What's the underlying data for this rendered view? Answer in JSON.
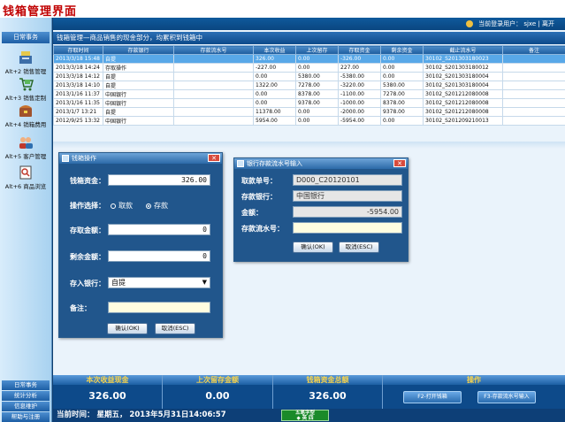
{
  "page_title": "钱箱管理界面",
  "topbar": {
    "user_label": "当前登录用户：",
    "user_name": "sjxe",
    "sep": "|",
    "logout": "离开"
  },
  "sidebar": {
    "header": "日常事务",
    "items": [
      {
        "label": "Alt+2 销售管理",
        "icon": "cash-register-icon"
      },
      {
        "label": "Alt+3 销售定制",
        "icon": "shopping-cart-icon"
      },
      {
        "label": "Alt+4 销箱费用",
        "icon": "money-chest-icon"
      },
      {
        "label": "Alt+5 客户管理",
        "icon": "customers-icon"
      },
      {
        "label": "Alt+6 商品浏览",
        "icon": "product-browse-icon"
      }
    ],
    "bottom": [
      "日常事务",
      "统计分析",
      "信息维护",
      "帮助与注册"
    ]
  },
  "main": {
    "header": "钱箱管理—商品销售的现金部分，均累积到钱箱中",
    "columns": [
      "存取时间",
      "存款银行",
      "存款流水号",
      "本次收益",
      "上次留存",
      "存取资金",
      "剩余资金",
      "截止流水号",
      "备注"
    ],
    "rows": [
      [
        "2013/3/18 15:48",
        "自提",
        "",
        "326.00",
        "0.00",
        "-326.00",
        "0.00",
        "30102_S201303180023",
        ""
      ],
      [
        "2013/3/18 14:24",
        "存取操作",
        "",
        "-227.00",
        "0.00",
        "227.00",
        "0.00",
        "30102_S201303180012",
        ""
      ],
      [
        "2013/3/18 14:12",
        "自提",
        "",
        "0.00",
        "5380.00",
        "-5380.00",
        "0.00",
        "30102_S201303180004",
        ""
      ],
      [
        "2013/3/18 14:10",
        "自提",
        "",
        "1322.00",
        "7278.00",
        "-3220.00",
        "5380.00",
        "30102_S201303180004",
        ""
      ],
      [
        "2013/1/16 11:37",
        "中国银行",
        "",
        "0.00",
        "8378.00",
        "-1100.00",
        "7278.00",
        "30102_S201212080008",
        ""
      ],
      [
        "2013/1/16 11:35",
        "中国银行",
        "",
        "0.00",
        "9378.00",
        "-1000.00",
        "8378.00",
        "30102_S201212080008",
        ""
      ],
      [
        "2013/1/7 13:21",
        "自提",
        "",
        "11378.00",
        "0.00",
        "-2000.00",
        "9378.00",
        "30102_S201212080008",
        ""
      ],
      [
        "2012/9/25 13:32",
        "中国银行",
        "",
        "5954.00",
        "0.00",
        "-5954.00",
        "0.00",
        "30102_S201209210013",
        ""
      ]
    ]
  },
  "cash_dialog": {
    "title": "钱箱操作",
    "balance_label": "钱箱资金：",
    "balance_value": "326.00",
    "op_label": "操作选择：",
    "op_withdraw": "取款",
    "op_deposit": "存款",
    "amount_label": "存取金额：",
    "amount_value": "0",
    "remain_label": "剩余金额：",
    "remain_value": "0",
    "bank_label": "存入银行：",
    "bank_value": "自提",
    "note_label": "备注：",
    "note_value": "",
    "ok": "确认(OK)",
    "cancel": "取消(ESC)"
  },
  "bank_dialog": {
    "title": "银行存款流水号输入",
    "doc_label": "取款单号：",
    "doc_value": "D000_C20120101",
    "bank_label": "存款银行：",
    "bank_value": "中国银行",
    "amount_label": "金额：",
    "amount_value": "-5954.00",
    "serial_label": "存款流水号：",
    "serial_value": "",
    "ok": "确认(OK)",
    "cancel": "取消(ESC)"
  },
  "stats": {
    "income_label": "本次收益现金",
    "income_value": "326.00",
    "last_label": "上次留存金额",
    "last_value": "0.00",
    "total_label": "钱箱资金总额",
    "total_value": "326.00",
    "ops_label": "操作",
    "btn_open": "F2-打开钱箱",
    "btn_serial": "F3-存款流水号输入"
  },
  "status": {
    "text": "当前时间： 星期五， 2013年5月31日14:06:57",
    "ime_line1": "五笔字型",
    "ime_line2": "◆ 英 四"
  },
  "colors": {
    "accent": "#21568c",
    "title_red": "#c00000",
    "selected_row": "#58a8e8"
  }
}
